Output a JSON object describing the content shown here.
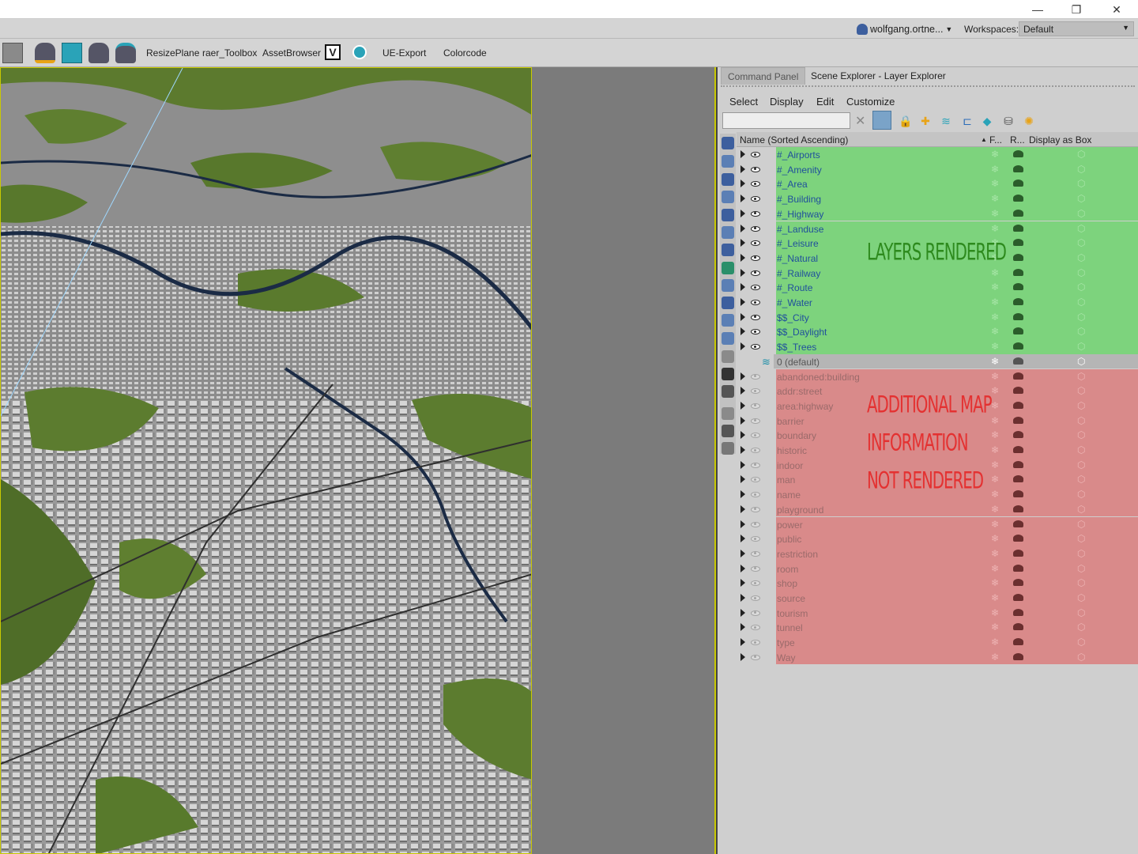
{
  "titlebar": {
    "minimize": "—",
    "restore": "❐",
    "close": "✕"
  },
  "account": {
    "user": "wolfgang.ortne...",
    "workspaces_label": "Workspaces:",
    "workspace": "Default"
  },
  "toolbar": {
    "items": [
      "ResizePlane",
      "raer_Toolbox",
      "AssetBrowser",
      "UE-Export",
      "Colorcode"
    ],
    "v_label": "V"
  },
  "panel": {
    "tabs": [
      "Command Panel",
      "Scene Explorer - Layer Explorer"
    ],
    "menu": [
      "Select",
      "Display",
      "Edit",
      "Customize"
    ],
    "search_placeholder": "",
    "columns": {
      "name": "Name (Sorted Ascending)",
      "frozen": "F...",
      "render": "R...",
      "box": "Display as Box"
    },
    "rendered_layers": [
      "#_Airports",
      "#_Amenity",
      "#_Area",
      "#_Building",
      "#_Highway",
      "#_Landuse",
      "#_Leisure",
      "#_Natural",
      "#_Railway",
      "#_Route",
      "#_Water",
      "$$_City",
      "$$_Daylight",
      "$$_Trees"
    ],
    "default_layer": "0 (default)",
    "hidden_layers": [
      "abandoned:building",
      "addr:street",
      "area:highway",
      "barrier",
      "boundary",
      "historic",
      "indoor",
      "man",
      "name",
      "playground",
      "power",
      "public",
      "restriction",
      "room",
      "shop",
      "source",
      "tourism",
      "tunnel",
      "type",
      "Way"
    ]
  },
  "annotations": {
    "rendered": "LAYERS RENDERED",
    "not_rendered_1": "ADDITIONAL MAP",
    "not_rendered_2": "INFORMATION",
    "not_rendered_3": "NOT RENDERED"
  },
  "colors": {
    "rendered_bg": "#7dd37d",
    "hidden_bg": "#d98a8a",
    "default_bg": "#b5b5b5",
    "viewport_border": "#c9c900"
  }
}
